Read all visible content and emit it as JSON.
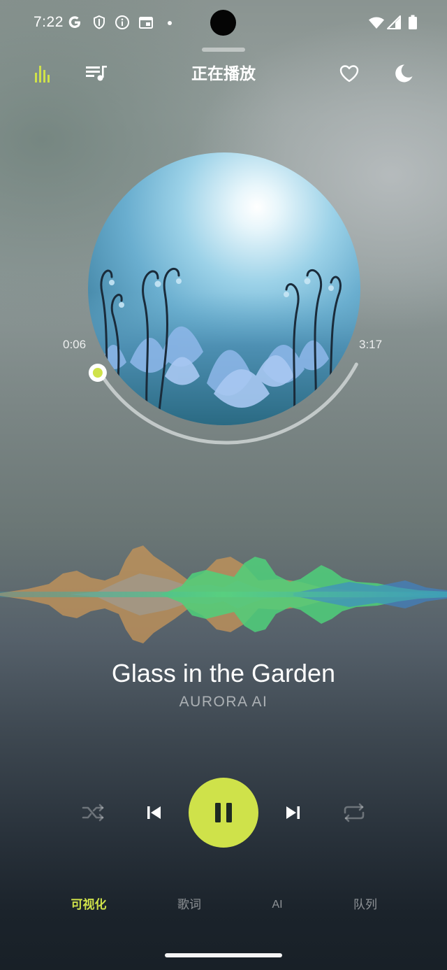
{
  "theme": {
    "accent": "#cfe24a",
    "accent_dark": "#1e2a22",
    "wave_orange": "#c8a060",
    "wave_green": "#4fd07a",
    "wave_blue": "#3a8fd0"
  },
  "status_bar": {
    "time": "7:22",
    "left_icons": [
      "google-g-icon",
      "shield-icon",
      "info-icon",
      "calendar-icon"
    ],
    "right_icons": [
      "wifi-icon",
      "cellular-signal-icon",
      "battery-icon"
    ]
  },
  "header": {
    "title": "正在播放",
    "left_icons": [
      "equalizer-icon",
      "playlist-icon"
    ],
    "right_icons": [
      "heart-icon",
      "moon-icon"
    ]
  },
  "player": {
    "elapsed": "0:06",
    "duration": "3:17",
    "progress": 0.03,
    "track_title": "Glass in the Garden",
    "artist": "AURORA AI"
  },
  "controls": {
    "icons": [
      "shuffle-icon",
      "skip-previous-icon",
      "pause-icon",
      "skip-next-icon",
      "repeat-icon"
    ]
  },
  "tabs": [
    {
      "label": "可视化",
      "active": true
    },
    {
      "label": "歌词",
      "active": false
    },
    {
      "label": "AI",
      "active": false
    },
    {
      "label": "队列",
      "active": false
    }
  ]
}
